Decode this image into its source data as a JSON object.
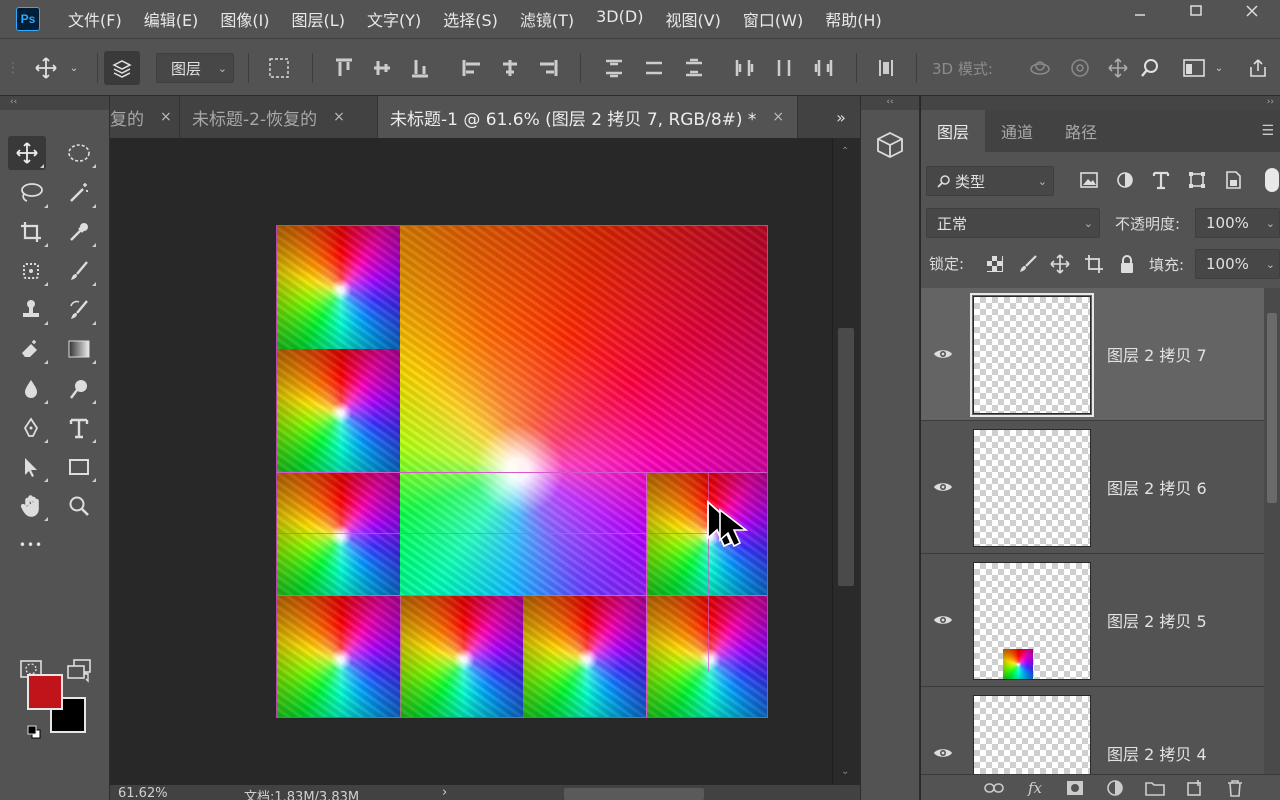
{
  "app": {
    "logo": "Ps"
  },
  "menubar": {
    "items": [
      "文件(F)",
      "编辑(E)",
      "图像(I)",
      "图层(L)",
      "文字(Y)",
      "选择(S)",
      "滤镜(T)",
      "3D(D)",
      "视图(V)",
      "窗口(W)",
      "帮助(H)"
    ],
    "window_controls": [
      "minimize-icon",
      "restore-icon",
      "close-icon"
    ]
  },
  "options_bar": {
    "auto_select_target": "图层",
    "mode_3d_label": "3D 模式:"
  },
  "collapse_glyph": "‹‹",
  "expand_glyph": "››",
  "tabs": [
    {
      "label": "复的",
      "active": false
    },
    {
      "label": "未标题-2-恢复的",
      "active": false
    },
    {
      "label": "未标题-1 @ 61.6% (图层 2 拷贝 7, RGB/8#) *",
      "active": true
    }
  ],
  "tab_close": "×",
  "tab_overflow": "»",
  "tools": {
    "more": "•••"
  },
  "colors": {
    "foreground": "#c0141a",
    "background": "#000000",
    "guide": "#d659c9",
    "accent_panel": "#535353"
  },
  "status": {
    "zoom": "61.62%",
    "doc": "文档:1.83M/3.83M",
    "arrow": "›"
  },
  "panel": {
    "tabs": [
      "图层",
      "通道",
      "路径"
    ],
    "filter_label": "类型",
    "blend_mode": "正常",
    "opacity_label": "不透明度:",
    "opacity_value": "100%",
    "lock_label": "锁定:",
    "fill_label": "填充:",
    "fill_value": "100%"
  },
  "layers": [
    {
      "name": "图层 2 拷贝 7",
      "selected": true,
      "visible": true
    },
    {
      "name": "图层 2 拷贝 6",
      "selected": false,
      "visible": true
    },
    {
      "name": "图层 2 拷贝 5",
      "selected": false,
      "visible": true
    },
    {
      "name": "图层 2 拷贝 4",
      "selected": false,
      "visible": true
    }
  ]
}
